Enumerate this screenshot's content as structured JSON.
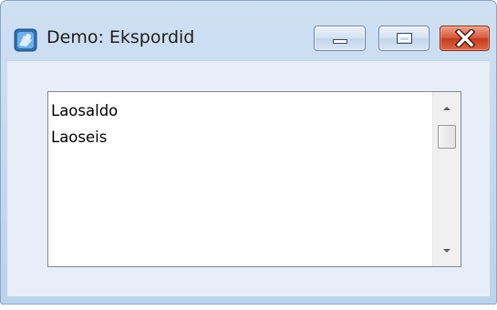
{
  "window": {
    "title": "Demo: Ekspordid",
    "app_icon": "app-icon",
    "caption_buttons": [
      {
        "name": "minimize",
        "icon": "minimize-icon"
      },
      {
        "name": "maximize",
        "icon": "maximize-icon"
      },
      {
        "name": "close",
        "icon": "close-icon"
      }
    ]
  },
  "list": {
    "items": [
      "Laosaldo",
      "Laoseis"
    ],
    "scrollbar": {
      "up_icon": "scroll-up-arrow-icon",
      "down_icon": "scroll-down-arrow-icon"
    }
  },
  "colors": {
    "frame": "#bcd3ec",
    "client": "#e8eef7",
    "close_button": "#c63a1f",
    "list_background": "#ffffff"
  }
}
